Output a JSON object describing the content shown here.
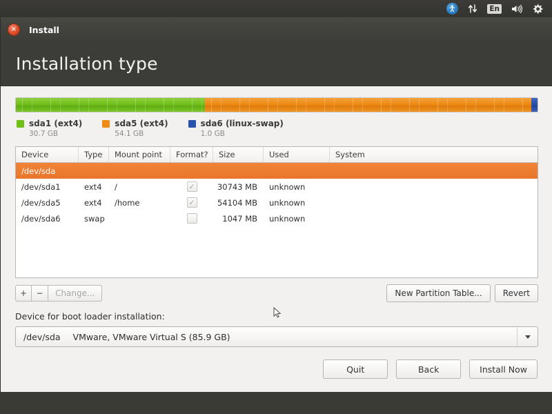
{
  "panel": {
    "icons": [
      {
        "name": "accessibility-icon",
        "glyph": "person"
      },
      {
        "name": "network-icon",
        "glyph": "↕"
      },
      {
        "name": "keyboard-layout-indicator",
        "glyph": "En"
      },
      {
        "name": "volume-icon",
        "glyph": "🔊"
      },
      {
        "name": "system-settings-icon",
        "glyph": "gear"
      }
    ],
    "keyboard_layout": "En"
  },
  "window": {
    "title": "Install",
    "close_glyph": "×"
  },
  "header": {
    "page_title": "Installation type"
  },
  "partition_bar": {
    "segments": [
      {
        "label": "sda1 (ext4)",
        "size": "30.7 GB",
        "color": "#6ec016",
        "percent": 36.2,
        "class": "seg-green"
      },
      {
        "label": "sda5 (ext4)",
        "size": "54.1 GB",
        "color": "#ef8b16",
        "percent": 62.6,
        "class": "seg-orange"
      },
      {
        "label": "sda6 (linux-swap)",
        "size": "1.0 GB",
        "color": "#2a53ab",
        "percent": 1.2,
        "class": "seg-blue"
      }
    ]
  },
  "table": {
    "headers": [
      "Device",
      "Type",
      "Mount point",
      "Format?",
      "Size",
      "Used",
      "System"
    ],
    "rows": [
      {
        "selected": true,
        "device": "/dev/sda",
        "type": "",
        "mount": "",
        "format": null,
        "size": "",
        "used": "",
        "system": ""
      },
      {
        "selected": false,
        "device": "/dev/sda1",
        "type": "ext4",
        "mount": "/",
        "format": true,
        "size": "30743 MB",
        "used": "unknown",
        "system": ""
      },
      {
        "selected": false,
        "device": "/dev/sda5",
        "type": "ext4",
        "mount": "/home",
        "format": true,
        "size": "54104 MB",
        "used": "unknown",
        "system": ""
      },
      {
        "selected": false,
        "device": "/dev/sda6",
        "type": "swap",
        "mount": "",
        "format": false,
        "size": "1047 MB",
        "used": "unknown",
        "system": ""
      }
    ]
  },
  "toolbar": {
    "add_label": "+",
    "remove_label": "−",
    "change_label": "Change...",
    "new_partition_table_label": "New Partition Table...",
    "revert_label": "Revert"
  },
  "boot_loader": {
    "label": "Device for boot loader installation:",
    "selected_device": "/dev/sda",
    "selected_description": "VMware, VMware Virtual S (85.9 GB)"
  },
  "actions": {
    "quit_label": "Quit",
    "back_label": "Back",
    "install_label": "Install Now"
  },
  "colors": {
    "accent_orange": "#e9762a",
    "header_dark": "#3c3c38",
    "content_bg": "#f2f1f0",
    "sda1_green": "#6ec016",
    "sda5_orange": "#ef8b16",
    "sda6_blue": "#2a53ab"
  }
}
